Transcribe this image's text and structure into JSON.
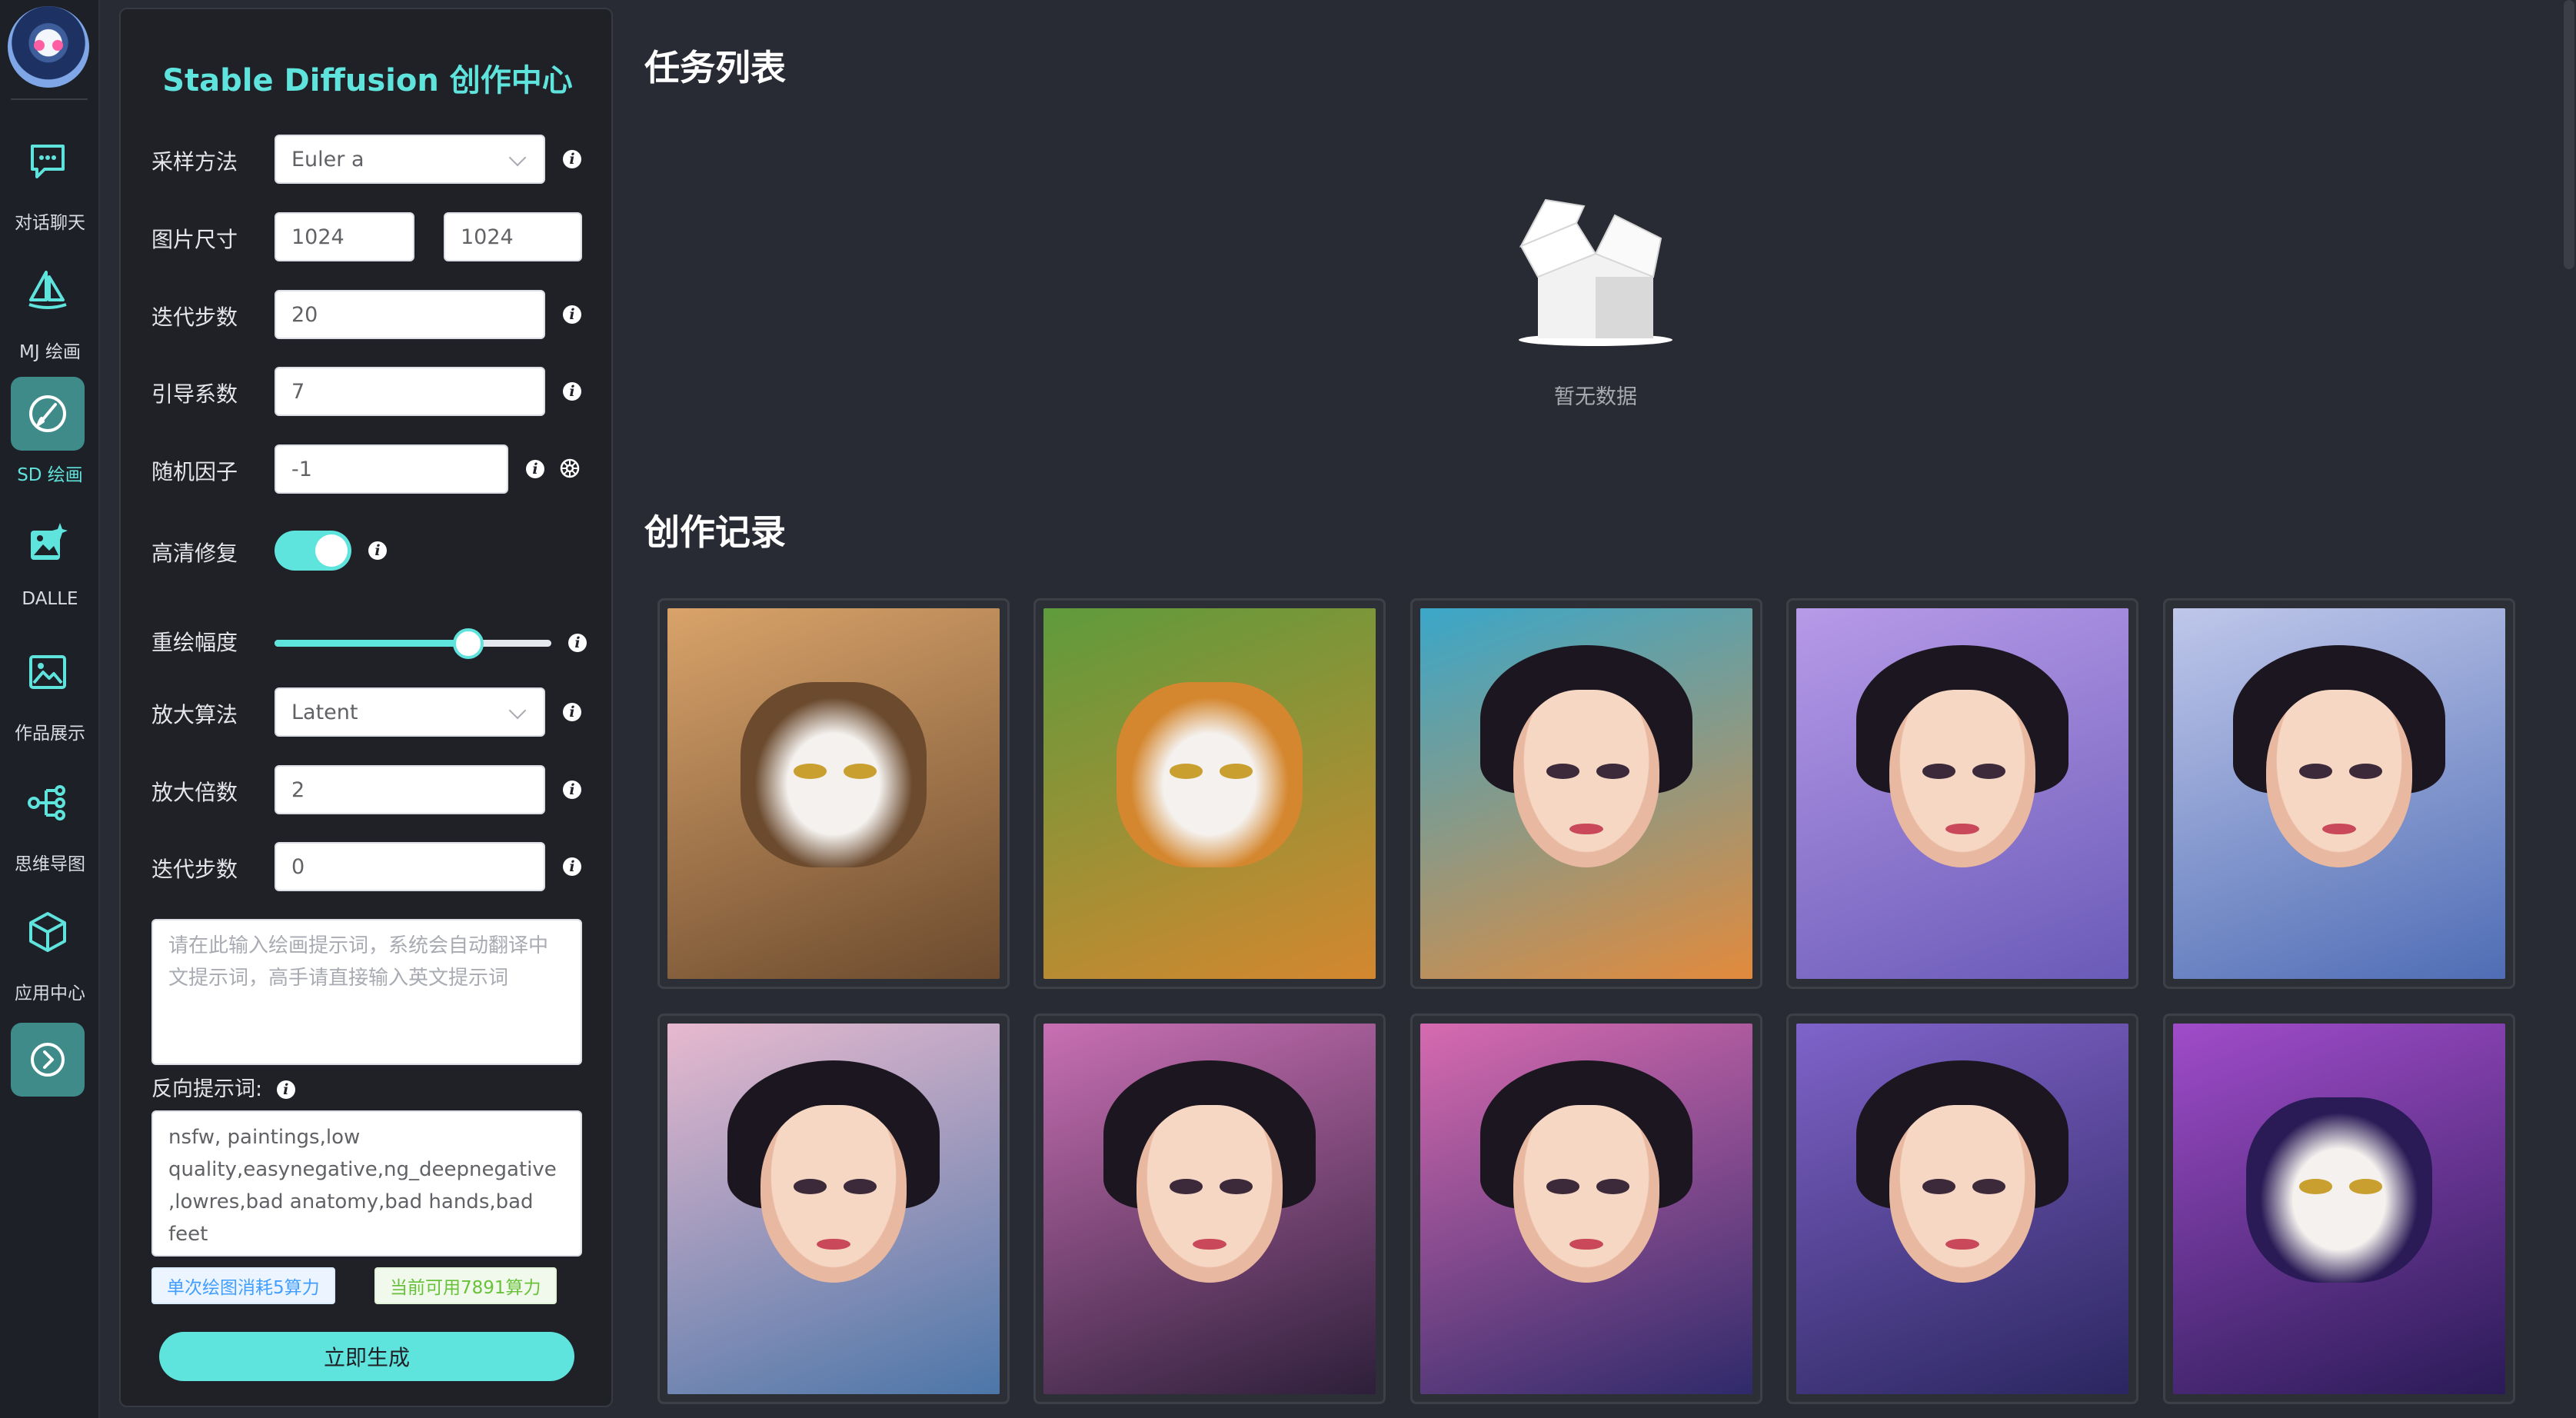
{
  "nav": {
    "items": [
      {
        "label": "对话聊天",
        "icon": "chat-icon"
      },
      {
        "label": "MJ 绘画",
        "icon": "sailboat-icon"
      },
      {
        "label": "SD 绘画",
        "icon": "brush-icon",
        "active": true
      },
      {
        "label": "DALLE",
        "icon": "image-sparkle-icon"
      },
      {
        "label": "作品展示",
        "icon": "gallery-icon"
      },
      {
        "label": "思维导图",
        "icon": "mindmap-icon"
      },
      {
        "label": "应用中心",
        "icon": "cube-icon"
      }
    ],
    "expand_icon": "chevron-right-circle-icon"
  },
  "panel": {
    "title": "Stable Diffusion 创作中心",
    "sampler": {
      "label": "采样方法",
      "value": "Euler a"
    },
    "size": {
      "label": "图片尺寸",
      "width": "1024",
      "height": "1024"
    },
    "steps": {
      "label": "迭代步数",
      "value": "20"
    },
    "cfg": {
      "label": "引导系数",
      "value": "7"
    },
    "seed": {
      "label": "随机因子",
      "value": "-1"
    },
    "hires": {
      "label": "高清修复",
      "enabled": true
    },
    "denoise": {
      "label": "重绘幅度",
      "value_fraction": 0.7
    },
    "upscaler": {
      "label": "放大算法",
      "value": "Latent"
    },
    "scale": {
      "label": "放大倍数",
      "value": "2"
    },
    "hires_steps": {
      "label": "迭代步数",
      "value": "0"
    },
    "prompt": {
      "placeholder": "请在此输入绘画提示词，系统会自动翻译中文提示词，高手请直接输入英文提示词"
    },
    "negative": {
      "label": "反向提示词:",
      "value": "nsfw, paintings,low quality,easynegative,ng_deepnegative ,lowres,bad anatomy,bad hands,bad feet"
    },
    "cost_tag": "单次绘图消耗5算力",
    "balance_tag": "当前可用7891算力",
    "generate_label": "立即生成"
  },
  "main": {
    "tasks_title": "任务列表",
    "empty_text": "暂无数据",
    "records_title": "创作记录",
    "images": [
      {
        "subject": "cat",
        "palette": [
          "#d9a36a",
          "#6b4a2e"
        ]
      },
      {
        "subject": "tiger",
        "palette": [
          "#5e9b3c",
          "#d4872f"
        ]
      },
      {
        "subject": "woman-portrait",
        "palette": [
          "#3aa7c9",
          "#e28a3c"
        ]
      },
      {
        "subject": "girl-purple-dress",
        "palette": [
          "#b79ae8",
          "#6a5bb8"
        ]
      },
      {
        "subject": "woman-blue-hanfu",
        "palette": [
          "#bfc7ea",
          "#4f6db5"
        ]
      },
      {
        "subject": "woman-kimono",
        "palette": [
          "#e7b9cf",
          "#4c76a8"
        ]
      },
      {
        "subject": "woman-jewel",
        "palette": [
          "#c86fb3",
          "#2d1f3a"
        ]
      },
      {
        "subject": "woman-flowers",
        "palette": [
          "#d76ab0",
          "#2f2a6a"
        ]
      },
      {
        "subject": "girl-blue-eyes",
        "palette": [
          "#7f63c9",
          "#2b2660"
        ]
      },
      {
        "subject": "fluffy-cat",
        "palette": [
          "#a04cc9",
          "#2a1b56"
        ]
      }
    ]
  }
}
